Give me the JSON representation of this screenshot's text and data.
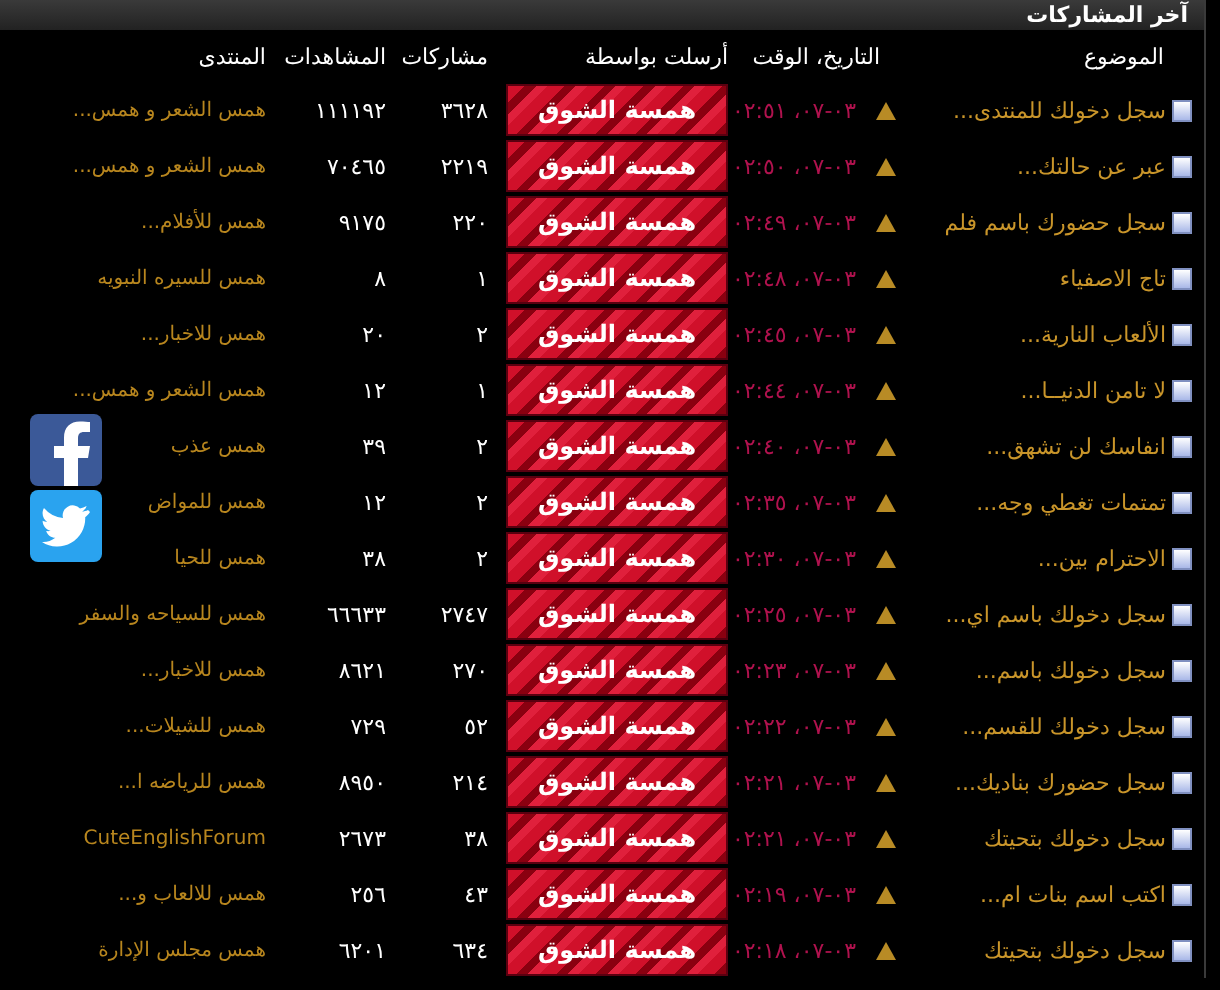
{
  "panel": {
    "title": "آخر المشاركات"
  },
  "columns": [
    "الموضوع",
    "التاريخ، الوقت",
    "أرسلت بواسطة",
    "مشاركات",
    "المشاهدات",
    "المنتدى"
  ],
  "rows": [
    {
      "topic": "سجل دخولك للمنتدى...",
      "date": "٠٣-٠٧، ٠٢:٥١",
      "poster": "همسة الشوق",
      "posts": "٣٦٢٨",
      "views": "١١١١٩٢",
      "forum": "همس الشعر و همس..."
    },
    {
      "topic": "عبر عن حالتك...",
      "date": "٠٣-٠٧، ٠٢:٥٠",
      "poster": "همسة الشوق",
      "posts": "٢٢١٩",
      "views": "٧٠٤٦٥",
      "forum": "همس الشعر و همس..."
    },
    {
      "topic": "سجل حضورك باسم فلم",
      "date": "٠٣-٠٧، ٠٢:٤٩",
      "poster": "همسة الشوق",
      "posts": "٢٢٠",
      "views": "٩١٧٥",
      "forum": "همس للأفلام..."
    },
    {
      "topic": "تاج الاصفياء",
      "date": "٠٣-٠٧، ٠٢:٤٨",
      "poster": "همسة الشوق",
      "posts": "١",
      "views": "٨",
      "forum": "همس للسيره النبويه"
    },
    {
      "topic": "الألعاب النارية...",
      "date": "٠٣-٠٧، ٠٢:٤٥",
      "poster": "همسة الشوق",
      "posts": "٢",
      "views": "٢٠",
      "forum": "همس للاخبار..."
    },
    {
      "topic": "لا تامن الدنيــا...",
      "date": "٠٣-٠٧، ٠٢:٤٤",
      "poster": "همسة الشوق",
      "posts": "١",
      "views": "١٢",
      "forum": "همس الشعر و همس..."
    },
    {
      "topic": "انفاسك لن تشهق...",
      "date": "٠٣-٠٧، ٠٢:٤٠",
      "poster": "همسة الشوق",
      "posts": "٢",
      "views": "٣٩",
      "forum": "همس عذب"
    },
    {
      "topic": "تمتمات تغطي وجه...",
      "date": "٠٣-٠٧، ٠٢:٣٥",
      "poster": "همسة الشوق",
      "posts": "٢",
      "views": "١٢",
      "forum": "همس للمواض"
    },
    {
      "topic": "الاحترام بين...",
      "date": "٠٣-٠٧، ٠٢:٣٠",
      "poster": "همسة الشوق",
      "posts": "٢",
      "views": "٣٨",
      "forum": "همس للحيا"
    },
    {
      "topic": "سجل دخولك باسم اي...",
      "date": "٠٣-٠٧، ٠٢:٢٥",
      "poster": "همسة الشوق",
      "posts": "٢٧٤٧",
      "views": "٦٦٦٣٣",
      "forum": "همس للسياحه والسفر"
    },
    {
      "topic": "سجل دخولك باسم...",
      "date": "٠٣-٠٧، ٠٢:٢٣",
      "poster": "همسة الشوق",
      "posts": "٢٧٠",
      "views": "٨٦٢١",
      "forum": "همس للاخبار..."
    },
    {
      "topic": "سجل دخولك للقسم...",
      "date": "٠٣-٠٧، ٠٢:٢٢",
      "poster": "همسة الشوق",
      "posts": "٥٢",
      "views": "٧٢٩",
      "forum": "همس للشيلات..."
    },
    {
      "topic": "سجل حضورك بناديك...",
      "date": "٠٣-٠٧، ٠٢:٢١",
      "poster": "همسة الشوق",
      "posts": "٢١٤",
      "views": "٨٩٥٠",
      "forum": "همس للرياضه ا..."
    },
    {
      "topic": "سجل دخولك بتحيتك",
      "date": "٠٣-٠٧، ٠٢:٢١",
      "poster": "همسة الشوق",
      "posts": "٣٨",
      "views": "٢٦٧٣",
      "forum": "CuteEnglishForum"
    },
    {
      "topic": "اكتب اسم بنات ام...",
      "date": "٠٣-٠٧، ٠٢:١٩",
      "poster": "همسة الشوق",
      "posts": "٤٣",
      "views": "٢٥٦",
      "forum": "همس للالعاب و..."
    },
    {
      "topic": "سجل دخولك بتحيتك",
      "date": "٠٣-٠٧، ٠٢:١٨",
      "poster": "همسة الشوق",
      "posts": "٦٣٤",
      "views": "٦٢٠١",
      "forum": "همس مجلس الإدارة"
    }
  ],
  "share": [
    {
      "kind": "facebook"
    },
    {
      "kind": "twitter"
    }
  ]
}
